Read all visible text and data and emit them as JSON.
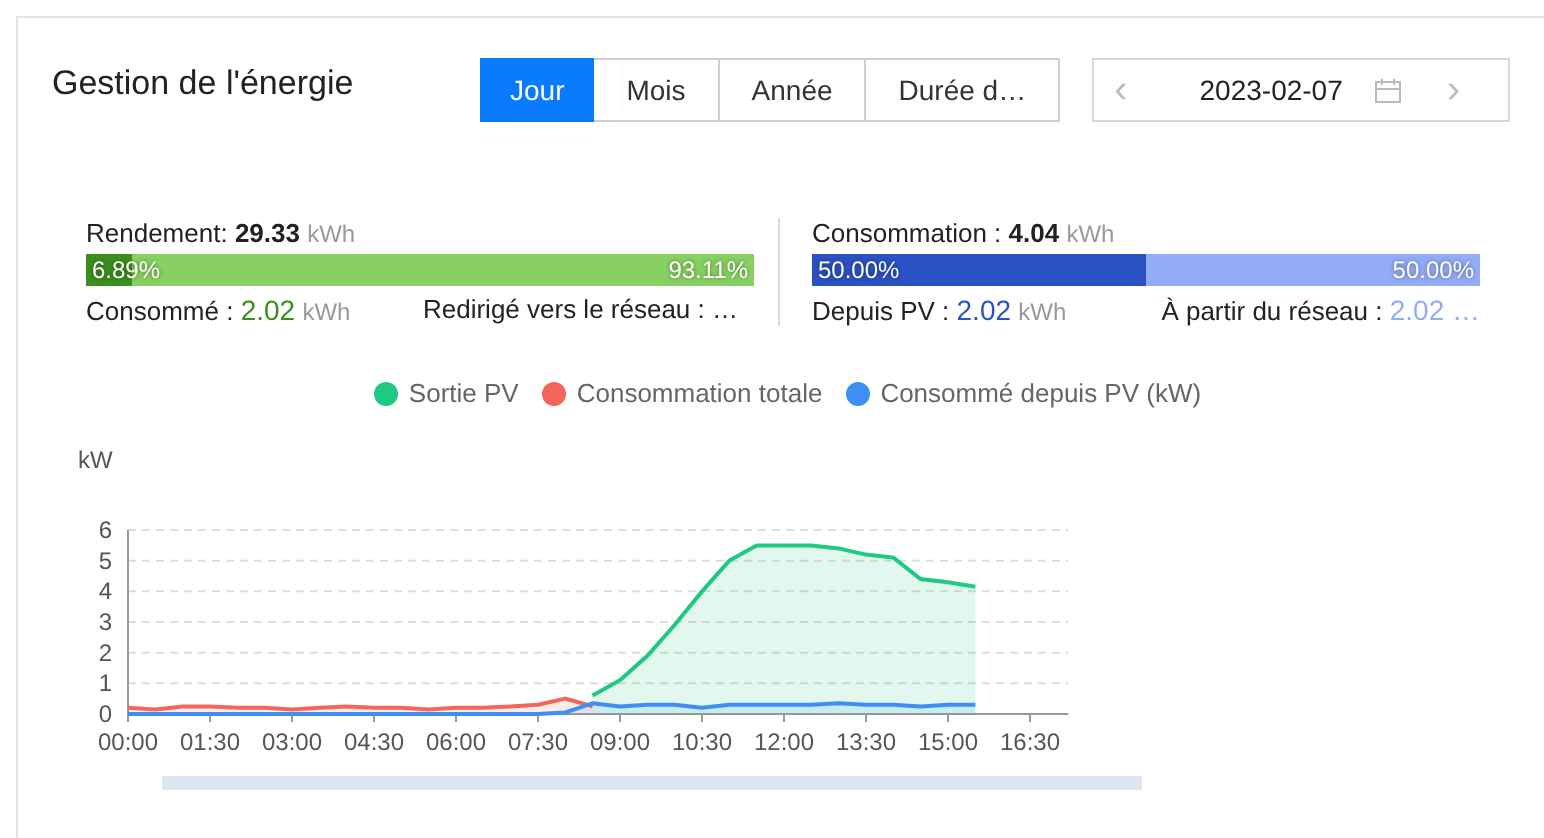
{
  "title": "Gestion de l'énergie",
  "tabs": [
    {
      "label": "Jour",
      "selected": true
    },
    {
      "label": "Mois",
      "selected": false
    },
    {
      "label": "Année",
      "selected": false
    },
    {
      "label": "Durée d…",
      "selected": false
    }
  ],
  "date_picker": {
    "value": "2023-02-07",
    "prev": "‹",
    "next": "›"
  },
  "stats": [
    {
      "label": "Rendement: ",
      "value": "29.33",
      "unit": "kWh",
      "level": 0.0689,
      "fill_label": "6.89%",
      "rest_label": "93.11%",
      "details": [
        {
          "label": "Consommé : ",
          "value": "2.02",
          "unit": "kWh",
          "color": "#3b8f1f"
        },
        {
          "label": "Redirigé vers le réseau : …"
        }
      ]
    },
    {
      "label": "Consommation : ",
      "value": "4.04",
      "unit": "kWh",
      "level": 0.5,
      "fill_label": "50.00%",
      "rest_label": "50.00%",
      "details": [
        {
          "label": "Depuis PV : ",
          "value": "2.02",
          "unit": "kWh",
          "color": "#2b52c4"
        },
        {
          "label": "À partir du réseau : ",
          "value": "2.02 …",
          "color": "#92acf8"
        }
      ]
    }
  ],
  "chart_data": {
    "type": "area",
    "ylabel": "kW",
    "ylim": [
      0,
      6
    ],
    "yticks": [
      0,
      1,
      2,
      3,
      4,
      5,
      6
    ],
    "grid": true,
    "xlim": [
      0,
      17.2
    ],
    "x": [
      0,
      0.5,
      1,
      1.5,
      2,
      2.5,
      3,
      3.5,
      4,
      4.5,
      5,
      5.5,
      6,
      6.5,
      7,
      7.5,
      8,
      8.5,
      9,
      9.5,
      10,
      10.5,
      11,
      11.5,
      12,
      12.5,
      13,
      13.5,
      14,
      14.5,
      15,
      15.5
    ],
    "xticks": [
      {
        "value": 0,
        "label": "00:00"
      },
      {
        "value": 1.5,
        "label": "01:30"
      },
      {
        "value": 3,
        "label": "03:00"
      },
      {
        "value": 4.5,
        "label": "04:30"
      },
      {
        "value": 6,
        "label": "06:00"
      },
      {
        "value": 7.5,
        "label": "07:30"
      },
      {
        "value": 9,
        "label": "09:00"
      },
      {
        "value": 10.5,
        "label": "10:30"
      },
      {
        "value": 12,
        "label": "12:00"
      },
      {
        "value": 13.5,
        "label": "13:30"
      },
      {
        "value": 15,
        "label": "15:00"
      },
      {
        "value": 16.5,
        "label": "16:30"
      }
    ],
    "series": [
      {
        "name": "Sortie PV",
        "color": "#1ec981",
        "values": [
          null,
          null,
          null,
          null,
          null,
          null,
          null,
          null,
          null,
          null,
          null,
          null,
          null,
          null,
          null,
          null,
          null,
          0.6,
          1.1,
          1.9,
          2.9,
          4.0,
          5.0,
          5.5,
          5.5,
          5.5,
          5.4,
          5.2,
          5.1,
          4.4,
          4.3,
          4.15
        ]
      },
      {
        "name": "Consommation totale",
        "color": "#f2675a",
        "values": [
          0.2,
          0.15,
          0.25,
          0.25,
          0.2,
          0.2,
          0.15,
          0.2,
          0.25,
          0.2,
          0.2,
          0.15,
          0.2,
          0.2,
          0.25,
          0.3,
          0.5,
          0.25,
          null,
          null,
          null,
          null,
          null,
          null,
          null,
          null,
          null,
          null,
          null,
          null,
          null,
          null
        ]
      },
      {
        "name": "Consommé depuis PV (kW)",
        "color": "#3d8ff5",
        "values": [
          0,
          0,
          0,
          0,
          0,
          0,
          0,
          0,
          0,
          0,
          0,
          0,
          0,
          0,
          0,
          0,
          0.05,
          0.35,
          0.25,
          0.3,
          0.3,
          0.2,
          0.3,
          0.3,
          0.3,
          0.3,
          0.35,
          0.3,
          0.3,
          0.25,
          0.3,
          0.3
        ]
      }
    ]
  }
}
